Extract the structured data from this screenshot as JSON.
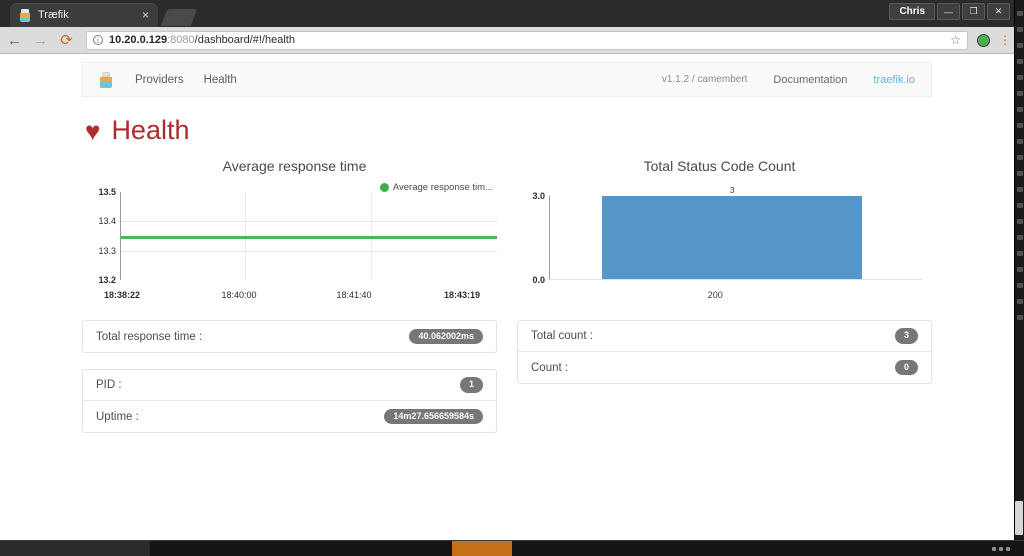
{
  "window": {
    "tab_title": "Træfik",
    "tab_close": "×",
    "user_button": "Chris",
    "minimize": "—",
    "maximize": "❐",
    "close": "✕"
  },
  "toolbar": {
    "back": "←",
    "forward": "→",
    "reload": "⟳",
    "url_host": "10.20.0.129",
    "url_port": ":8080",
    "url_path": "/dashboard/#!/health",
    "bookmark": "☆",
    "menu": "⋮"
  },
  "navbar": {
    "brand_icon": "traefik-logo-icon",
    "links": [
      {
        "label": "Providers"
      },
      {
        "label": "Health"
      }
    ],
    "version": "v1.1.2 / camembert",
    "documentation": "Documentation",
    "site": "traefik.io"
  },
  "header": {
    "icon": "♥",
    "title": "Health"
  },
  "chart_data": [
    {
      "type": "line",
      "title": "Average response time",
      "xlabel": "",
      "ylabel": "",
      "ylim": [
        13.2,
        13.5
      ],
      "yticks": [
        "13.2",
        "13.3",
        "13.4",
        "13.5"
      ],
      "xticks": [
        "18:38:22",
        "18:40:00",
        "18:41:40",
        "18:43:19"
      ],
      "grid": true,
      "legend_position": "top-right",
      "series": [
        {
          "name": "Average response tim...",
          "color": "#4cb85c",
          "constant_value": 13.35,
          "values": [
            13.35,
            13.35,
            13.35,
            13.35,
            13.35,
            13.35,
            13.35,
            13.35,
            13.35
          ]
        }
      ]
    },
    {
      "type": "bar",
      "title": "Total Status Code Count",
      "categories": [
        "200"
      ],
      "values": [
        3
      ],
      "value_labels": [
        "3"
      ],
      "xlabel": "",
      "ylabel": "",
      "ylim": [
        0.0,
        3.0
      ],
      "yticks": [
        "0.0",
        "3.0"
      ],
      "color": "#5496c8",
      "grid": false
    }
  ],
  "panels": {
    "left": [
      {
        "rows": [
          {
            "label": "Total response time :",
            "value": "40.062002ms"
          }
        ]
      },
      {
        "rows": [
          {
            "label": "PID :",
            "value": "1"
          },
          {
            "label": "Uptime :",
            "value": "14m27.656659584s"
          }
        ]
      }
    ],
    "right": [
      {
        "rows": [
          {
            "label": "Total count :",
            "value": "3"
          },
          {
            "label": "Count :",
            "value": "0"
          }
        ]
      }
    ]
  },
  "taskbar": {
    "clock": ""
  },
  "colors": {
    "accent_red": "#b02b2b",
    "series_green": "#4cb85c",
    "bar_blue": "#5496c8",
    "badge_gray": "#777777",
    "link_blue": "#5bb7e6"
  }
}
